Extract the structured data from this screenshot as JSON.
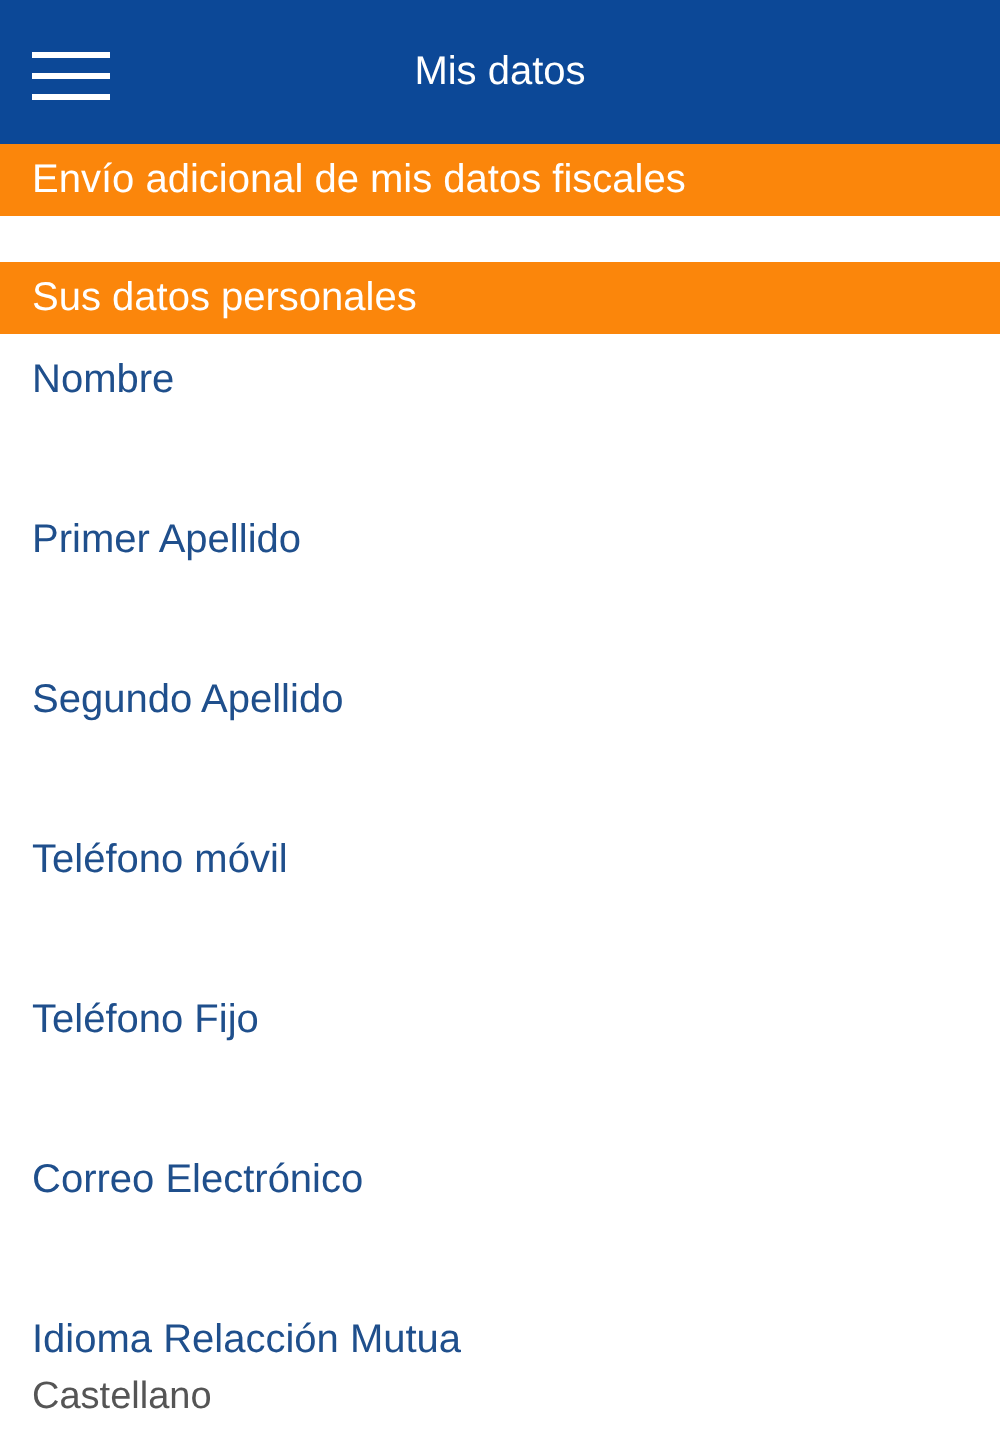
{
  "header": {
    "title": "Mis datos"
  },
  "sections": [
    {
      "title": "Envío adicional de mis datos fiscales"
    },
    {
      "title": "Sus datos personales",
      "fields": [
        {
          "label": "Nombre"
        },
        {
          "label": "Primer Apellido"
        },
        {
          "label": "Segundo Apellido"
        },
        {
          "label": "Teléfono móvil"
        },
        {
          "label": "Teléfono Fijo"
        },
        {
          "label": "Correo Electrónico"
        },
        {
          "label": "Idioma Relacción Mutua",
          "value": "Castellano"
        }
      ]
    }
  ]
}
